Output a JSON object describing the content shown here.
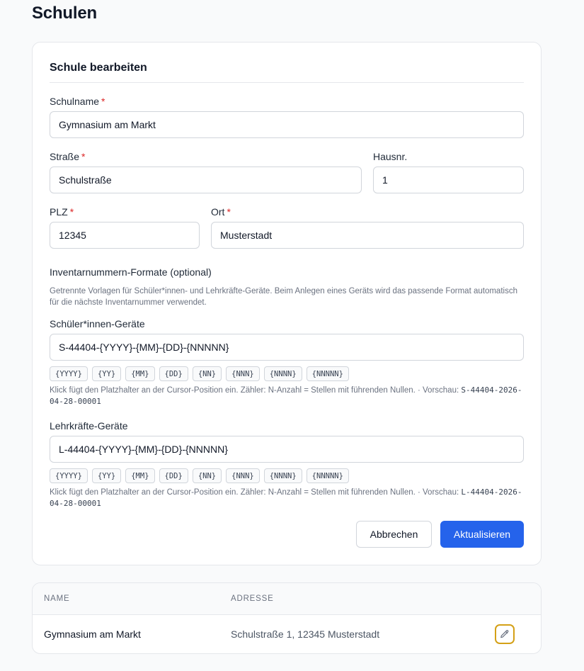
{
  "page": {
    "title": "Schulen"
  },
  "form": {
    "title": "Schule bearbeiten",
    "required_marker": "*",
    "schulname": {
      "label": "Schulname",
      "value": "Gymnasium am Markt"
    },
    "strasse": {
      "label": "Straße",
      "value": "Schulstraße"
    },
    "hausnr": {
      "label": "Hausnr.",
      "value": "1"
    },
    "plz": {
      "label": "PLZ",
      "value": "12345"
    },
    "ort": {
      "label": "Ort",
      "value": "Musterstadt"
    },
    "formats": {
      "heading": "Inventarnummern-Formate (optional)",
      "description": "Getrennte Vorlagen für Schüler*innen- und Lehrkräfte-Geräte. Beim Anlegen eines Geräts wird das passende Format automatisch für die nächste Inventarnummer verwendet.",
      "schueler": {
        "label": "Schüler*innen-Geräte",
        "value": "S-44404-{YYYY}-{MM}-{DD}-{NNNNN}",
        "hint": "Klick fügt den Platzhalter an der Cursor-Position ein. Zähler: N-Anzahl = Stellen mit führenden Nullen. · Vorschau: ",
        "preview": "S-44404-2026-04-28-00001"
      },
      "lehrkraefte": {
        "label": "Lehrkräfte-Geräte",
        "value": "L-44404-{YYYY}-{MM}-{DD}-{NNNNN}",
        "hint": "Klick fügt den Platzhalter an der Cursor-Position ein. Zähler: N-Anzahl = Stellen mit führenden Nullen. · Vorschau: ",
        "preview": "L-44404-2026-04-28-00001"
      },
      "placeholders": [
        "{YYYY}",
        "{YY}",
        "{MM}",
        "{DD}",
        "{NN}",
        "{NNN}",
        "{NNNN}",
        "{NNNNN}"
      ]
    },
    "cancel_label": "Abbrechen",
    "submit_label": "Aktualisieren"
  },
  "table": {
    "columns": [
      "NAME",
      "ADRESSE"
    ],
    "rows": [
      {
        "name": "Gymnasium am Markt",
        "address": "Schulstraße 1, 12345 Musterstadt",
        "action_icon": "pencil-icon"
      }
    ]
  },
  "colors": {
    "primary": "#2563eb",
    "required": "#dc2626",
    "edit_border": "#d4a017"
  }
}
